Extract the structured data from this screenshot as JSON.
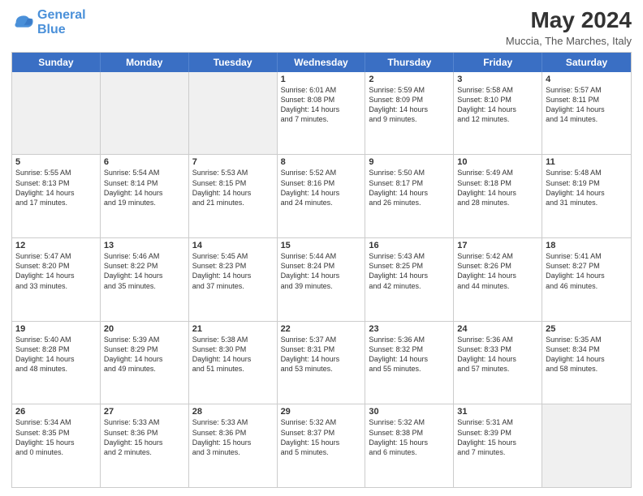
{
  "logo": {
    "line1": "General",
    "line2": "Blue"
  },
  "title": "May 2024",
  "location": "Muccia, The Marches, Italy",
  "header_days": [
    "Sunday",
    "Monday",
    "Tuesday",
    "Wednesday",
    "Thursday",
    "Friday",
    "Saturday"
  ],
  "rows": [
    [
      {
        "day": "",
        "info": "",
        "shaded": true
      },
      {
        "day": "",
        "info": "",
        "shaded": true
      },
      {
        "day": "",
        "info": "",
        "shaded": true
      },
      {
        "day": "1",
        "info": "Sunrise: 6:01 AM\nSunset: 8:08 PM\nDaylight: 14 hours\nand 7 minutes."
      },
      {
        "day": "2",
        "info": "Sunrise: 5:59 AM\nSunset: 8:09 PM\nDaylight: 14 hours\nand 9 minutes."
      },
      {
        "day": "3",
        "info": "Sunrise: 5:58 AM\nSunset: 8:10 PM\nDaylight: 14 hours\nand 12 minutes."
      },
      {
        "day": "4",
        "info": "Sunrise: 5:57 AM\nSunset: 8:11 PM\nDaylight: 14 hours\nand 14 minutes."
      }
    ],
    [
      {
        "day": "5",
        "info": "Sunrise: 5:55 AM\nSunset: 8:13 PM\nDaylight: 14 hours\nand 17 minutes."
      },
      {
        "day": "6",
        "info": "Sunrise: 5:54 AM\nSunset: 8:14 PM\nDaylight: 14 hours\nand 19 minutes."
      },
      {
        "day": "7",
        "info": "Sunrise: 5:53 AM\nSunset: 8:15 PM\nDaylight: 14 hours\nand 21 minutes."
      },
      {
        "day": "8",
        "info": "Sunrise: 5:52 AM\nSunset: 8:16 PM\nDaylight: 14 hours\nand 24 minutes."
      },
      {
        "day": "9",
        "info": "Sunrise: 5:50 AM\nSunset: 8:17 PM\nDaylight: 14 hours\nand 26 minutes."
      },
      {
        "day": "10",
        "info": "Sunrise: 5:49 AM\nSunset: 8:18 PM\nDaylight: 14 hours\nand 28 minutes."
      },
      {
        "day": "11",
        "info": "Sunrise: 5:48 AM\nSunset: 8:19 PM\nDaylight: 14 hours\nand 31 minutes."
      }
    ],
    [
      {
        "day": "12",
        "info": "Sunrise: 5:47 AM\nSunset: 8:20 PM\nDaylight: 14 hours\nand 33 minutes."
      },
      {
        "day": "13",
        "info": "Sunrise: 5:46 AM\nSunset: 8:22 PM\nDaylight: 14 hours\nand 35 minutes."
      },
      {
        "day": "14",
        "info": "Sunrise: 5:45 AM\nSunset: 8:23 PM\nDaylight: 14 hours\nand 37 minutes."
      },
      {
        "day": "15",
        "info": "Sunrise: 5:44 AM\nSunset: 8:24 PM\nDaylight: 14 hours\nand 39 minutes."
      },
      {
        "day": "16",
        "info": "Sunrise: 5:43 AM\nSunset: 8:25 PM\nDaylight: 14 hours\nand 42 minutes."
      },
      {
        "day": "17",
        "info": "Sunrise: 5:42 AM\nSunset: 8:26 PM\nDaylight: 14 hours\nand 44 minutes."
      },
      {
        "day": "18",
        "info": "Sunrise: 5:41 AM\nSunset: 8:27 PM\nDaylight: 14 hours\nand 46 minutes."
      }
    ],
    [
      {
        "day": "19",
        "info": "Sunrise: 5:40 AM\nSunset: 8:28 PM\nDaylight: 14 hours\nand 48 minutes."
      },
      {
        "day": "20",
        "info": "Sunrise: 5:39 AM\nSunset: 8:29 PM\nDaylight: 14 hours\nand 49 minutes."
      },
      {
        "day": "21",
        "info": "Sunrise: 5:38 AM\nSunset: 8:30 PM\nDaylight: 14 hours\nand 51 minutes."
      },
      {
        "day": "22",
        "info": "Sunrise: 5:37 AM\nSunset: 8:31 PM\nDaylight: 14 hours\nand 53 minutes."
      },
      {
        "day": "23",
        "info": "Sunrise: 5:36 AM\nSunset: 8:32 PM\nDaylight: 14 hours\nand 55 minutes."
      },
      {
        "day": "24",
        "info": "Sunrise: 5:36 AM\nSunset: 8:33 PM\nDaylight: 14 hours\nand 57 minutes."
      },
      {
        "day": "25",
        "info": "Sunrise: 5:35 AM\nSunset: 8:34 PM\nDaylight: 14 hours\nand 58 minutes."
      }
    ],
    [
      {
        "day": "26",
        "info": "Sunrise: 5:34 AM\nSunset: 8:35 PM\nDaylight: 15 hours\nand 0 minutes."
      },
      {
        "day": "27",
        "info": "Sunrise: 5:33 AM\nSunset: 8:36 PM\nDaylight: 15 hours\nand 2 minutes."
      },
      {
        "day": "28",
        "info": "Sunrise: 5:33 AM\nSunset: 8:36 PM\nDaylight: 15 hours\nand 3 minutes."
      },
      {
        "day": "29",
        "info": "Sunrise: 5:32 AM\nSunset: 8:37 PM\nDaylight: 15 hours\nand 5 minutes."
      },
      {
        "day": "30",
        "info": "Sunrise: 5:32 AM\nSunset: 8:38 PM\nDaylight: 15 hours\nand 6 minutes."
      },
      {
        "day": "31",
        "info": "Sunrise: 5:31 AM\nSunset: 8:39 PM\nDaylight: 15 hours\nand 7 minutes."
      },
      {
        "day": "",
        "info": "",
        "shaded": true
      }
    ]
  ]
}
